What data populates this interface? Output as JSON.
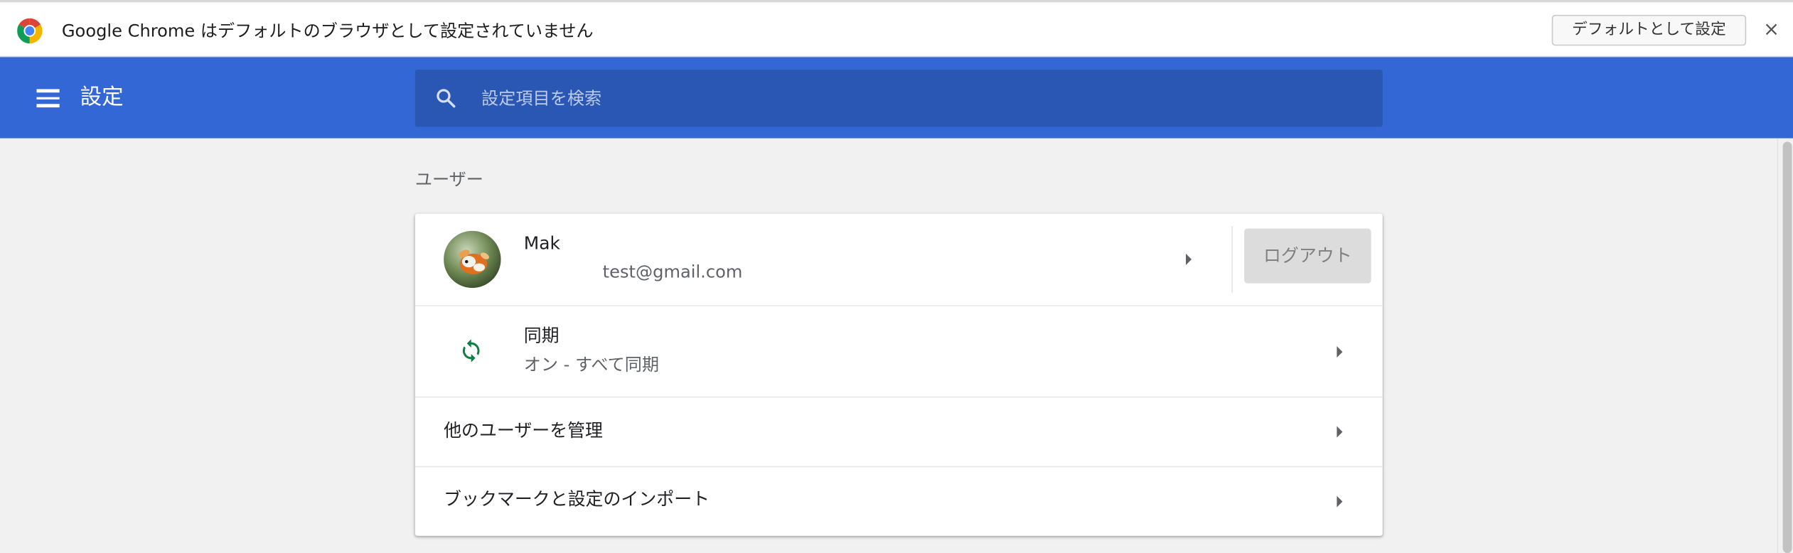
{
  "infobar": {
    "message": "Google Chrome はデフォルトのブラウザとして設定されていません",
    "default_button": "デフォルトとして設定",
    "close_label": "×",
    "logo_icon": "chrome-logo-icon"
  },
  "header": {
    "title": "設定",
    "menu_icon": "hamburger-menu-icon",
    "search_placeholder": "設定項目を検索",
    "search_value": "",
    "search_icon": "search-icon",
    "background_color": "#3367d6",
    "search_background_color": "#2a56b4"
  },
  "people": {
    "section_title": "ユーザー",
    "profile": {
      "name": "Mak",
      "email": "test@gmail.com",
      "logout_label": "ログアウト"
    },
    "sync": {
      "label": "同期",
      "status": "オン - すべて同期",
      "icon": "sync-icon",
      "icon_color": "#0b8043"
    },
    "manage_users_label": "他のユーザーを管理",
    "import_label": "ブックマークと設定のインポート"
  }
}
